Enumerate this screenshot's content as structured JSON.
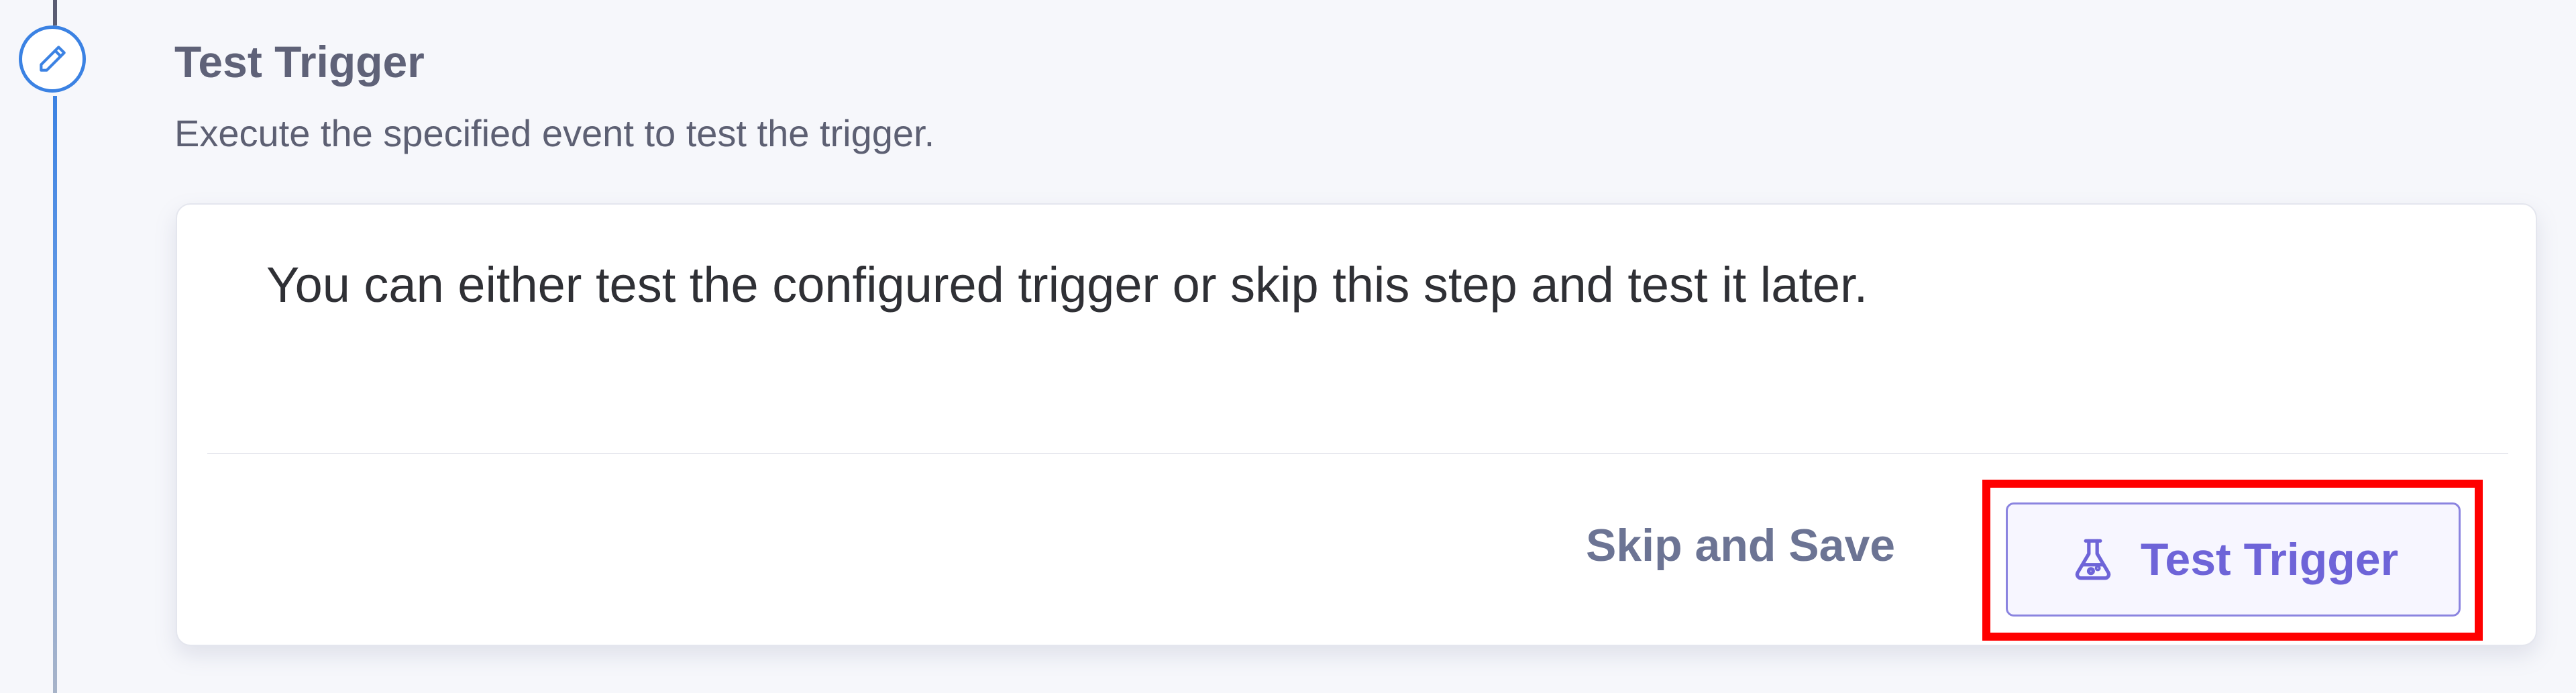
{
  "step": {
    "title": "Test Trigger",
    "description": "Execute the specified event to test the trigger.",
    "icon": "pencil-icon"
  },
  "card": {
    "message": "You can either test the configured trigger or skip this step and test it later.",
    "skip_label": "Skip and Save",
    "test_label": "Test Trigger",
    "test_icon": "flask-icon"
  },
  "colors": {
    "accent_blue": "#3b82e3",
    "button_purple": "#6e64d8",
    "highlight_red": "#ff0000"
  }
}
